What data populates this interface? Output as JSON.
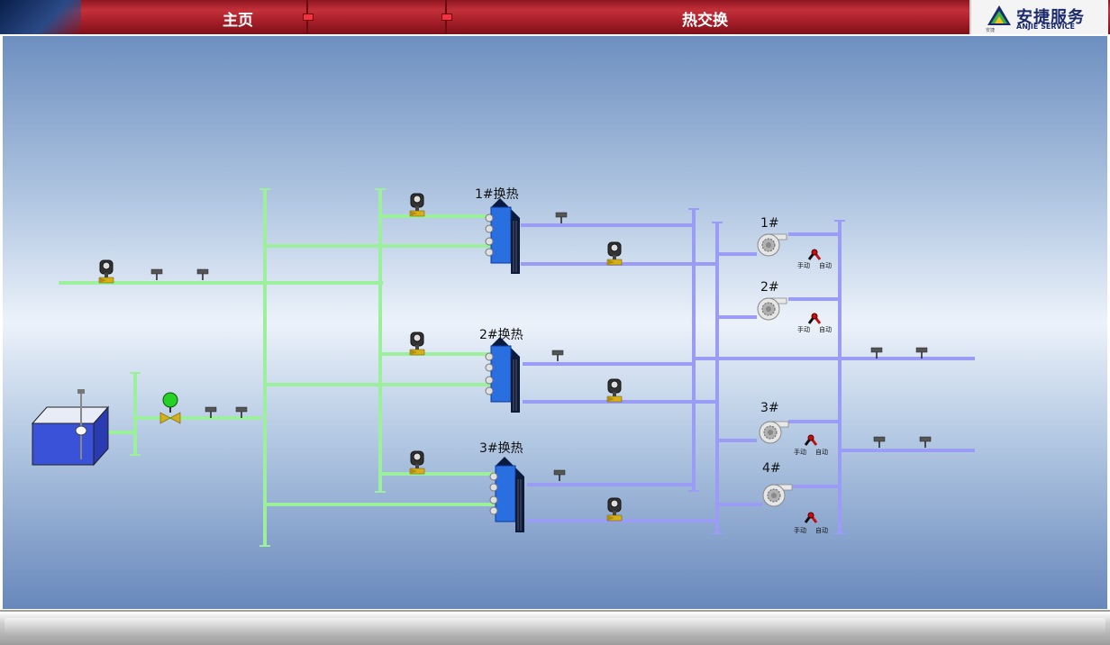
{
  "header": {
    "nav_home": "主页",
    "nav_heat_exchange": "热交换",
    "logo_cn": "安捷服务",
    "logo_en": "ANJIE SERVICE",
    "logo_sub": "安捷",
    "colors": {
      "bar": "#b0202a",
      "accent": "#1a2a6c"
    }
  },
  "diagram": {
    "exchangers": [
      "1#换热",
      "2#换热",
      "3#换热"
    ],
    "pumps": [
      "1#",
      "2#",
      "3#",
      "4#"
    ],
    "mode_manual": "手动",
    "mode_auto": "自动",
    "colors": {
      "supply_pipe": "#8ef08e",
      "return_pipe": "#8a8cf0",
      "exchanger": "#2a6fe0",
      "tank": "#3a52d8"
    }
  }
}
